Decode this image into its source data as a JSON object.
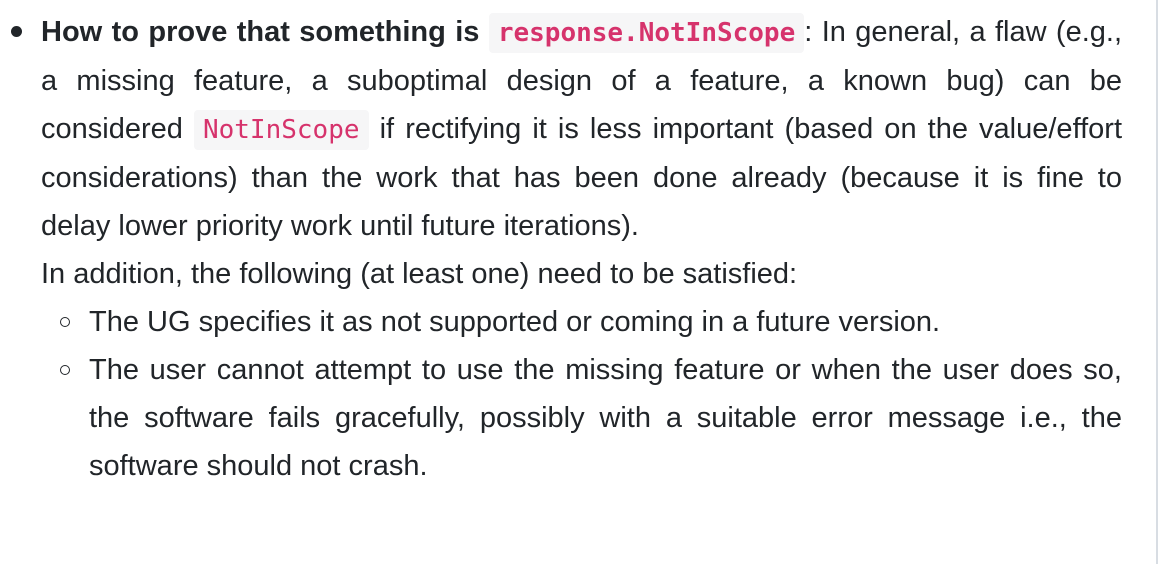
{
  "item": {
    "lead": "How to prove that something is",
    "lead_code": "response.NotInScope",
    "sep": ":",
    "text_part1": "In general, a flaw (e.g., a missing feature, a suboptimal design of a feature, a known bug) can be considered",
    "inline_code": "NotInScope",
    "text_part2": "if rectifying it is less important (based on the value/effort considerations) than the work that has been done already (because it is fine to delay lower priority work until future iterations).",
    "addition": "In addition, the following (at least one) need to be satisfied:",
    "subitems": [
      "The UG specifies it as not supported or coming in a future version.",
      "The user cannot attempt to use the missing feature or when the user does so, the software fails gracefully, possibly with a suitable error message i.e., the software should not crash."
    ]
  }
}
